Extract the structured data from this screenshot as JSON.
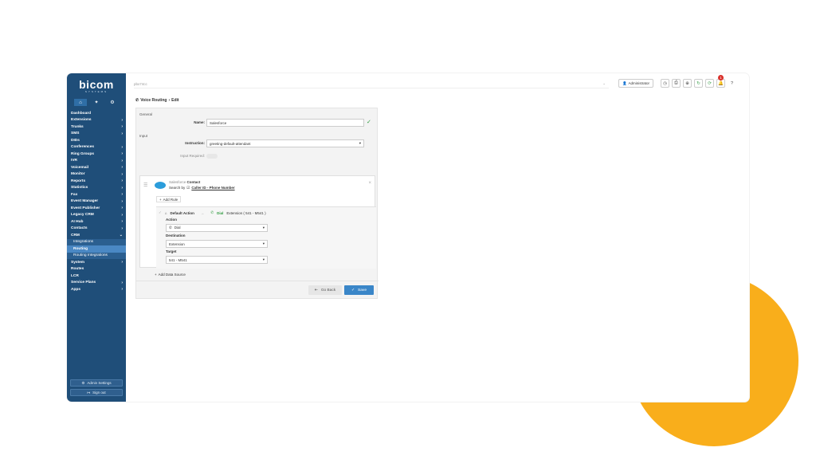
{
  "brand": {
    "name": "bicom",
    "tagline": "SYSTEMS"
  },
  "sidebar": {
    "items": [
      {
        "label": "Dashboard",
        "chev": ""
      },
      {
        "label": "Extensions",
        "chev": "›"
      },
      {
        "label": "Trunks",
        "chev": "›"
      },
      {
        "label": "SMS",
        "chev": "›"
      },
      {
        "label": "DIDs",
        "chev": ""
      },
      {
        "label": "Conferences",
        "chev": "›"
      },
      {
        "label": "Ring Groups",
        "chev": "›"
      },
      {
        "label": "IVR",
        "chev": "›"
      },
      {
        "label": "Voicemail",
        "chev": "›"
      },
      {
        "label": "Monitor",
        "chev": "›"
      },
      {
        "label": "Reports",
        "chev": "›"
      },
      {
        "label": "Statistics",
        "chev": "›"
      },
      {
        "label": "Fax",
        "chev": "›"
      },
      {
        "label": "Event Manager",
        "chev": "›"
      },
      {
        "label": "Event Publisher",
        "chev": "›"
      },
      {
        "label": "Legacy CRM",
        "chev": "›"
      },
      {
        "label": "AI Hub",
        "chev": "›"
      },
      {
        "label": "Contacts",
        "chev": "›"
      },
      {
        "label": "CRM",
        "chev": "⌄"
      }
    ],
    "crm_sub": [
      "Integrations",
      "Routing",
      "Routing Integrations"
    ],
    "items_after": [
      {
        "label": "System",
        "chev": "›"
      },
      {
        "label": "Routes",
        "chev": ""
      },
      {
        "label": "LCR",
        "chev": ""
      },
      {
        "label": "Service Plans",
        "chev": "›"
      },
      {
        "label": "Apps",
        "chev": "›"
      }
    ],
    "admin_settings": "Admin Settings",
    "sign_out": "Sign out"
  },
  "topbar": {
    "url": "pbx74cc",
    "user": "Administrator",
    "notifications": "1"
  },
  "breadcrumb": {
    "section": "Voice Routing",
    "sep": "›",
    "page": "Edit"
  },
  "general": {
    "title": "General",
    "name_label": "Name:",
    "name_value": "Salesforce"
  },
  "input": {
    "title": "Input",
    "instruction_label": "Instruction:",
    "instruction_value": "greeting-default-attendant",
    "input_required_label": "Input Required:"
  },
  "source": {
    "name": "Salesforce",
    "type": "Contact",
    "search_by": "Search by",
    "search_field": "Caller ID - Phone Number",
    "add_rule": "Add Rule",
    "default_action": "Default Action",
    "dial": "Dial",
    "dial_target": "Extension ( 541 - M541 )",
    "action_label": "Action",
    "action_value": "Dial",
    "destination_label": "Destination",
    "destination_value": "Extension",
    "target_label": "Target",
    "target_value": "541 - M541",
    "add_data_source": "Add Data Source"
  },
  "buttons": {
    "go_back": "Go Back",
    "save": "Save"
  },
  "colors": {
    "sidebar": "#1f4e79",
    "primary": "#3a86c8",
    "accent": "#f9ae1b",
    "success": "#2e9a3e"
  }
}
